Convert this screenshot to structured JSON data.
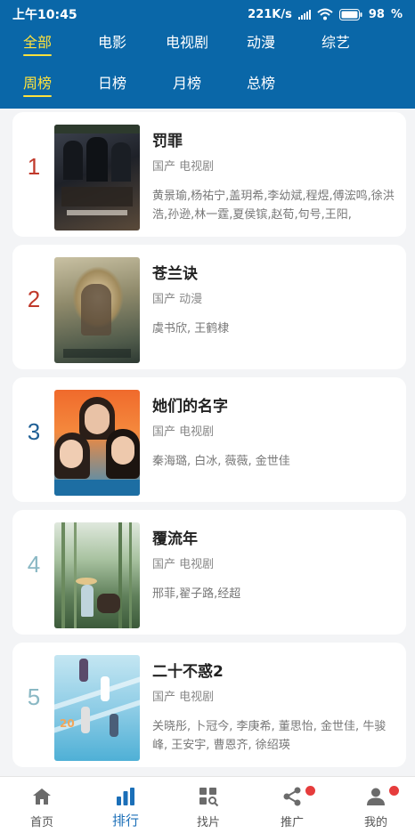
{
  "status_bar": {
    "time": "上午10:45",
    "network_speed": "221K/s",
    "battery": "98"
  },
  "category_tabs": [
    {
      "label": "全部",
      "active": true
    },
    {
      "label": "电影",
      "active": false
    },
    {
      "label": "电视剧",
      "active": false
    },
    {
      "label": "动漫",
      "active": false
    },
    {
      "label": "综艺",
      "active": false
    }
  ],
  "ranking_tabs": [
    {
      "label": "周榜",
      "active": true
    },
    {
      "label": "日榜",
      "active": false
    },
    {
      "label": "月榜",
      "active": false
    },
    {
      "label": "总榜",
      "active": false
    }
  ],
  "items": [
    {
      "rank": "1",
      "rank_color": "#c0392b",
      "title": "罚罪",
      "meta": "国产 电视剧",
      "cast": "黄景瑜,杨祐宁,盖玥希,李幼斌,程煜,傅浤鸣,徐洪浩,孙逊,林一霆,夏侯镔,赵荀,句号,王阳,"
    },
    {
      "rank": "2",
      "rank_color": "#c0392b",
      "title": "苍兰诀",
      "meta": "国产 动漫",
      "cast": "虞书欣, 王鹤棣"
    },
    {
      "rank": "3",
      "rank_color": "#1f5f95",
      "title": "她们的名字",
      "meta": "国产 电视剧",
      "cast": "秦海璐, 白冰, 薇薇, 金世佳"
    },
    {
      "rank": "4",
      "rank_color": "#8ab8c4",
      "title": "覆流年",
      "meta": "国产 电视剧",
      "cast": "邢菲,翟子路,经超"
    },
    {
      "rank": "5",
      "rank_color": "#8ab8c4",
      "title": "二十不惑2",
      "meta": "国产 电视剧",
      "cast": "关晓彤, 卜冠今, 李庚希, 董思怡, 金世佳, 牛骏峰, 王安宇, 曹恩齐, 徐绍瑛"
    }
  ],
  "bottom_nav": [
    {
      "label": "首页",
      "icon": "home-icon",
      "active": false
    },
    {
      "label": "排行",
      "icon": "ranking-icon",
      "active": true
    },
    {
      "label": "找片",
      "icon": "find-icon",
      "active": false
    },
    {
      "label": "推广",
      "icon": "share-icon",
      "active": false,
      "badge": true
    },
    {
      "label": "我的",
      "icon": "user-icon",
      "active": false,
      "badge": true
    }
  ],
  "colors": {
    "header_bg": "#0a67a8",
    "active_tab": "#ffe23d",
    "active_nav": "#1b6fb8",
    "badge": "#e63c3c"
  }
}
